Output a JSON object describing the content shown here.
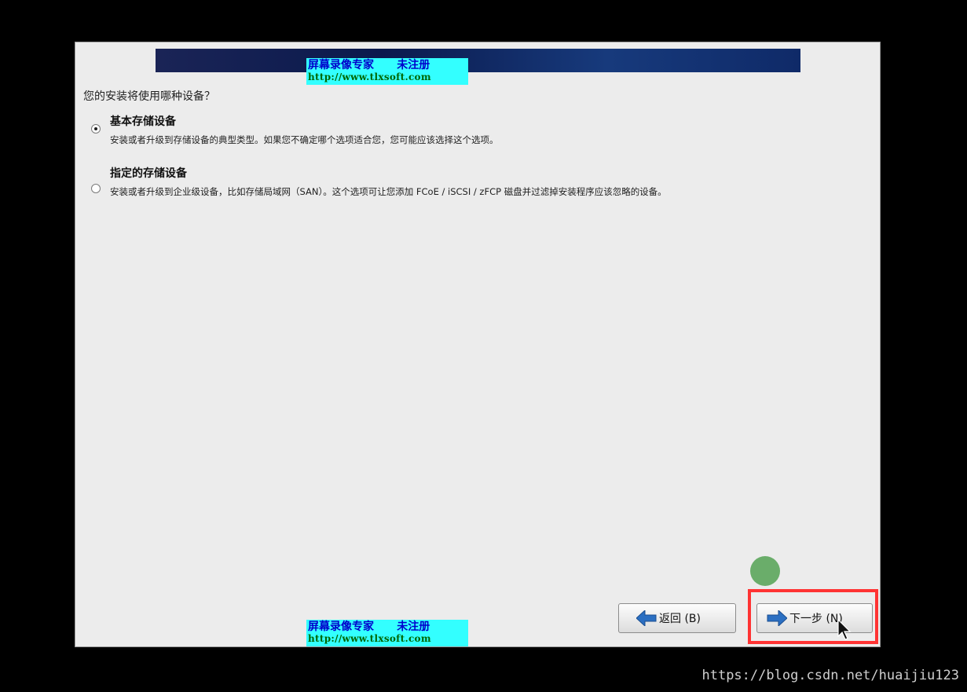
{
  "watermark": {
    "line1": "屏幕录像专家      未注册",
    "line2": "http://www.tlxsoft.com"
  },
  "question": "您的安装将使用哪种设备？",
  "options": [
    {
      "title": "基本存储设备",
      "description": "安装或者升级到存储设备的典型类型。如果您不确定哪个选项适合您，您可能应该选择这个选项。",
      "selected": true
    },
    {
      "title": "指定的存储设备",
      "description": "安装或者升级到企业级设备，比如存储局域网（SAN）。这个选项可让您添加 FCoE / iSCSI / zFCP 磁盘并过滤掉安装程序应该忽略的设备。",
      "selected": false
    }
  ],
  "buttons": {
    "back": "返回 (B)",
    "next": "下一步 (N)"
  },
  "icons": {
    "back": "arrow-left-icon",
    "next": "arrow-right-icon"
  },
  "colors": {
    "accent_arrow": "#2b6fc2",
    "highlight": "#ff3333",
    "click_marker": "#6aad6a"
  },
  "footer_url": "https://blog.csdn.net/huaijiu123"
}
